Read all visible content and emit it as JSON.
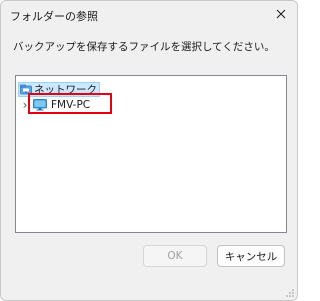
{
  "window": {
    "title": "フォルダーの参照",
    "close_label": "✕"
  },
  "prompt": "バックアップを保存するファイルを選択してください。",
  "tree": {
    "root_label": "ネットワーク",
    "root_icon": "network-folder-icon",
    "child_label": "FMV-PC",
    "child_icon": "computer-monitor-icon",
    "child_expander": "›"
  },
  "buttons": {
    "ok_label": "OK",
    "cancel_label": "キャンセル"
  },
  "colors": {
    "highlight": "#e60012",
    "selection_bg": "#cce8ff",
    "selection_border": "#99d1ff",
    "dialog_bg": "#f0f0f0"
  }
}
